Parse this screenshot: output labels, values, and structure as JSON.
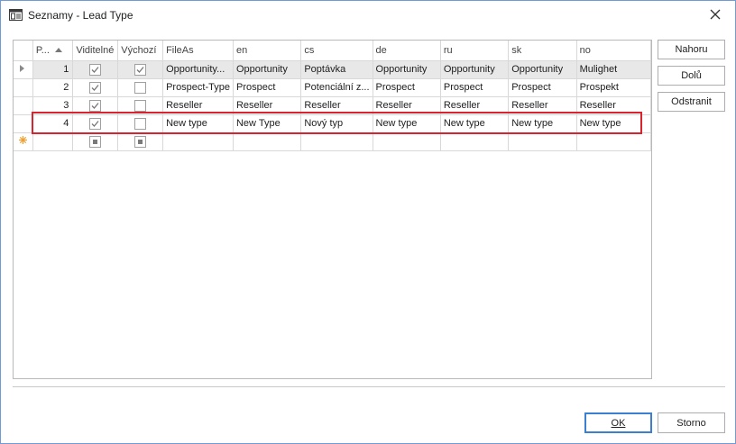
{
  "window": {
    "title": "Seznamy - Lead Type",
    "icon": "list-form-icon",
    "close_icon": "close-icon"
  },
  "grid": {
    "columns": [
      {
        "label": "P...",
        "sorted": "ascending"
      },
      {
        "label": "Viditelné"
      },
      {
        "label": "Výchozí"
      },
      {
        "label": "FileAs"
      },
      {
        "label": "en"
      },
      {
        "label": "cs"
      },
      {
        "label": "de"
      },
      {
        "label": "ru"
      },
      {
        "label": "sk"
      },
      {
        "label": "no"
      }
    ],
    "rows": [
      {
        "indicator": "current",
        "order": "1",
        "visible": true,
        "default": true,
        "fileas": "Opportunity...",
        "en": "Opportunity",
        "cs": "Poptávka",
        "de": "Opportunity",
        "ru": "Opportunity",
        "sk": "Opportunity",
        "no": "Mulighet"
      },
      {
        "indicator": "",
        "order": "2",
        "visible": true,
        "default": false,
        "fileas": "Prospect-Type",
        "en": "Prospect",
        "cs": "Potenciální z...",
        "de": "Prospect",
        "ru": "Prospect",
        "sk": "Prospect",
        "no": "Prospekt"
      },
      {
        "indicator": "",
        "order": "3",
        "visible": true,
        "default": false,
        "fileas": "Reseller",
        "en": "Reseller",
        "cs": "Reseller",
        "de": "Reseller",
        "ru": "Reseller",
        "sk": "Reseller",
        "no": "Reseller"
      },
      {
        "indicator": "",
        "order": "4",
        "visible": true,
        "default": false,
        "fileas": "New type",
        "en": "New Type",
        "cs": "Nový typ",
        "de": "New type",
        "ru": "New type",
        "sk": "New type",
        "no": "New type"
      }
    ],
    "new_row_indicator": "new-row-star-icon"
  },
  "side_buttons": {
    "up": "Nahoru",
    "down": "Dolů",
    "remove": "Odstranit"
  },
  "footer": {
    "ok": "OK",
    "cancel": "Storno"
  },
  "colors": {
    "highlight": "#d9232e",
    "focused_row": "#e8e8e8",
    "new_row_star": "#f0a030"
  }
}
